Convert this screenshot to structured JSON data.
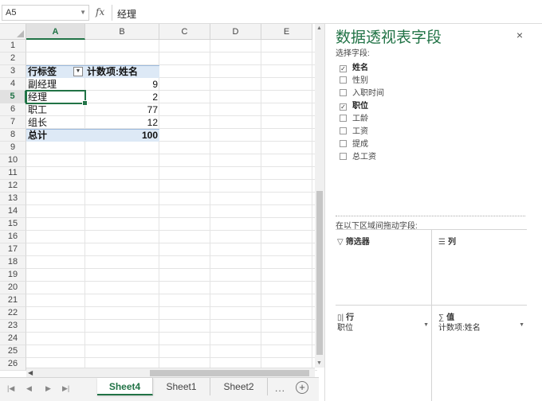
{
  "formula_bar": {
    "name_box": "A5",
    "fx": "fx",
    "value": "经理"
  },
  "columns": [
    "A",
    "B",
    "C",
    "D",
    "E"
  ],
  "rows": [
    "1",
    "2",
    "3",
    "4",
    "5",
    "6",
    "7",
    "8",
    "9",
    "10",
    "11",
    "12",
    "13",
    "14",
    "15",
    "16",
    "17",
    "18",
    "19",
    "20",
    "21",
    "22",
    "23",
    "24",
    "25",
    "26"
  ],
  "pivot_table": {
    "header_row_label": "行标签",
    "header_value_label": "计数项:姓名",
    "rows": [
      {
        "label": "副经理",
        "value": "9"
      },
      {
        "label": "经理",
        "value": "2"
      },
      {
        "label": "职工",
        "value": "77"
      },
      {
        "label": "组长",
        "value": "12"
      }
    ],
    "total_label": "总计",
    "total_value": "100"
  },
  "sheet_tabs": [
    "Sheet4",
    "Sheet1",
    "Sheet2"
  ],
  "active_sheet": "Sheet4",
  "tabs_more": "...",
  "pane": {
    "title": "数据透视表字段",
    "close": "×",
    "choose_label": "选择字段:",
    "fields": [
      {
        "label": "姓名",
        "checked": true
      },
      {
        "label": "性别",
        "checked": false
      },
      {
        "label": "入职时间",
        "checked": false
      },
      {
        "label": "职位",
        "checked": true
      },
      {
        "label": "工龄",
        "checked": false
      },
      {
        "label": "工资",
        "checked": false
      },
      {
        "label": "提成",
        "checked": false
      },
      {
        "label": "总工资",
        "checked": false
      }
    ],
    "drag_hint": "在以下区域间拖动字段:",
    "areas": {
      "filters": {
        "label": "筛选器"
      },
      "columns": {
        "label": "列"
      },
      "rows": {
        "label": "行",
        "item": "职位"
      },
      "values": {
        "label": "值",
        "item": "计数项:姓名"
      }
    }
  },
  "colors": {
    "accent": "#217346",
    "header_band": "#dde9f6"
  }
}
